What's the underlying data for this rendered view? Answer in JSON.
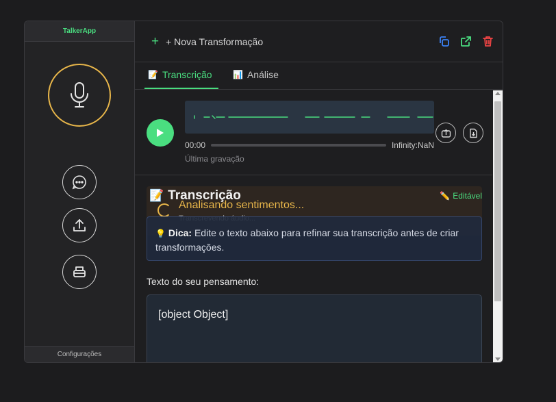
{
  "app": {
    "title": "TalkerApp",
    "settings_label": "Configurações"
  },
  "toolbar": {
    "new_label": "+ Nova Transformação"
  },
  "tabs": [
    {
      "label": "Transcrição",
      "icon": "memo-icon",
      "active": true
    },
    {
      "label": "Análise",
      "icon": "bar-chart-icon",
      "active": false
    }
  ],
  "player": {
    "current_time": "00:00",
    "duration": "Infinity:NaN",
    "caption": "Última gravação",
    "progress": 0
  },
  "transcription": {
    "title": "Transcrição",
    "editable_label": "Editável",
    "loading_title": "Analisando sentimentos...",
    "loading_subtitle": "Transcrevendo áudio...",
    "tip_bold": "Dica:",
    "tip_text": " Edite o texto abaixo para refinar sua transcrição antes de criar transformações.",
    "field_label": "Texto do seu pensamento:",
    "field_value": "[object Object]"
  },
  "colors": {
    "accent": "#4ade80",
    "mic_ring": "#e8b64a",
    "loading_text": "#e8b64a",
    "delete": "#ef4444",
    "action_blue": "#3b82f6"
  }
}
